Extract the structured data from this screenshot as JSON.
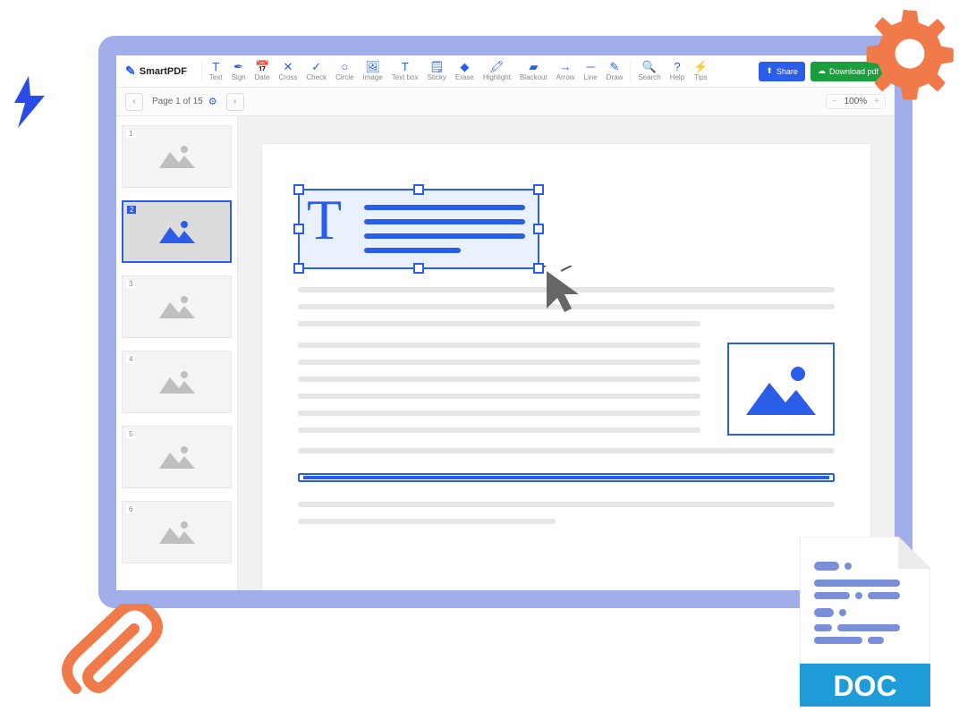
{
  "app": {
    "name": "SmartPDF"
  },
  "toolbar": {
    "tools": [
      "Text",
      "Sign",
      "Date",
      "Cross",
      "Check",
      "Circle",
      "Image",
      "Text box",
      "Sticky",
      "Erase",
      "Highlight",
      "Blackout",
      "Arrow",
      "Line",
      "Draw"
    ],
    "aux": [
      "Search",
      "Help",
      "Tips"
    ],
    "share": "Share",
    "download": "Download pdf"
  },
  "pageInfo": {
    "label": "Page 1 of 15"
  },
  "zoom": {
    "value": "100%"
  },
  "thumbs": {
    "count": 6,
    "selected": 2
  },
  "decor": {
    "doc_label": "DOC"
  }
}
